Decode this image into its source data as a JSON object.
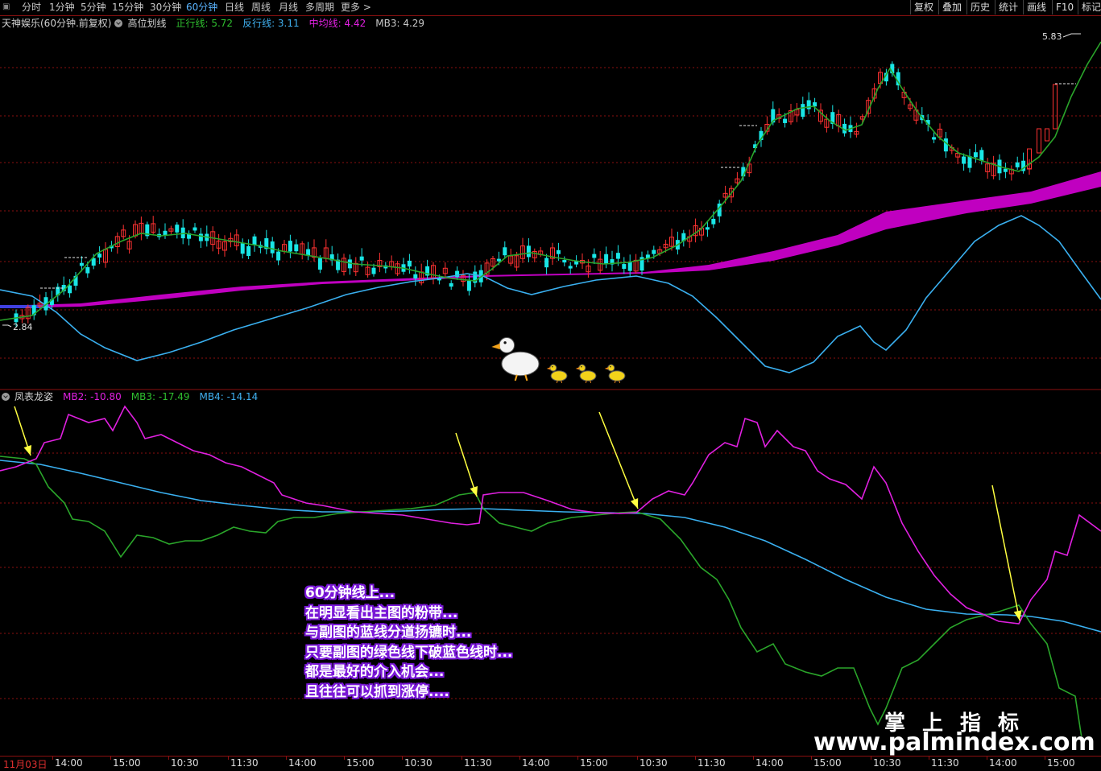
{
  "toolbar": {
    "periods": [
      "分时",
      "1分钟",
      "5分钟",
      "15分钟",
      "30分钟",
      "60分钟",
      "日线",
      "周线",
      "月线",
      "多周期",
      "更多 >"
    ],
    "active_period": "60分钟",
    "right_buttons": [
      "复权",
      "叠加",
      "历史",
      "统计",
      "画线",
      "F10",
      "标记"
    ]
  },
  "main_legend": {
    "stock": "天神娱乐(60分钟.前复权)",
    "indicator": "高位划线",
    "items": [
      {
        "label": "正行线:",
        "value": "5.72",
        "color": "#2fbf2f"
      },
      {
        "label": "反行线:",
        "value": "3.11",
        "color": "#40b0f0"
      },
      {
        "label": "中均线:",
        "value": "4.42",
        "color": "#e020e0"
      },
      {
        "label": "MB3:",
        "value": "4.29",
        "color": "#c8c8c8"
      }
    ]
  },
  "price_marks": {
    "high": "5.83",
    "low": "2.84"
  },
  "sub_legend": {
    "indicator": "凤表龙姿",
    "items": [
      {
        "label": "MB2:",
        "value": "-10.80",
        "color": "#e020e0"
      },
      {
        "label": "MB3:",
        "value": "-17.49",
        "color": "#2fbf2f"
      },
      {
        "label": "MB4:",
        "value": "-14.14",
        "color": "#40b0f0"
      }
    ]
  },
  "annotation_lines": [
    "60分钟线上...",
    "在明显看出主图的粉带...",
    "与副图的蓝线分道扬镳时...",
    "只要副图的绿色线下破蓝色线时...",
    "都是最好的介入机会...",
    "且往往可以抓到涨停...."
  ],
  "watermark": {
    "title": "掌上指标",
    "url": "www.palmindex.com"
  },
  "time_axis": [
    "11月03日",
    "14:00",
    "15:00",
    "10:30",
    "11:30",
    "14:00",
    "15:00",
    "10:30",
    "11:30",
    "14:00",
    "15:00",
    "10:30",
    "11:30",
    "14:00",
    "15:00",
    "10:30",
    "11:30",
    "14:00",
    "15:00"
  ],
  "colors": {
    "up": "#ff3232",
    "down": "#19e6e6",
    "green_line": "#2aa52a",
    "blue_line": "#3ab0f0",
    "pink_band": "#c000c0",
    "magenta_line": "#e020e0",
    "grid": "#8b1010",
    "arrow": "#ffff40"
  }
}
